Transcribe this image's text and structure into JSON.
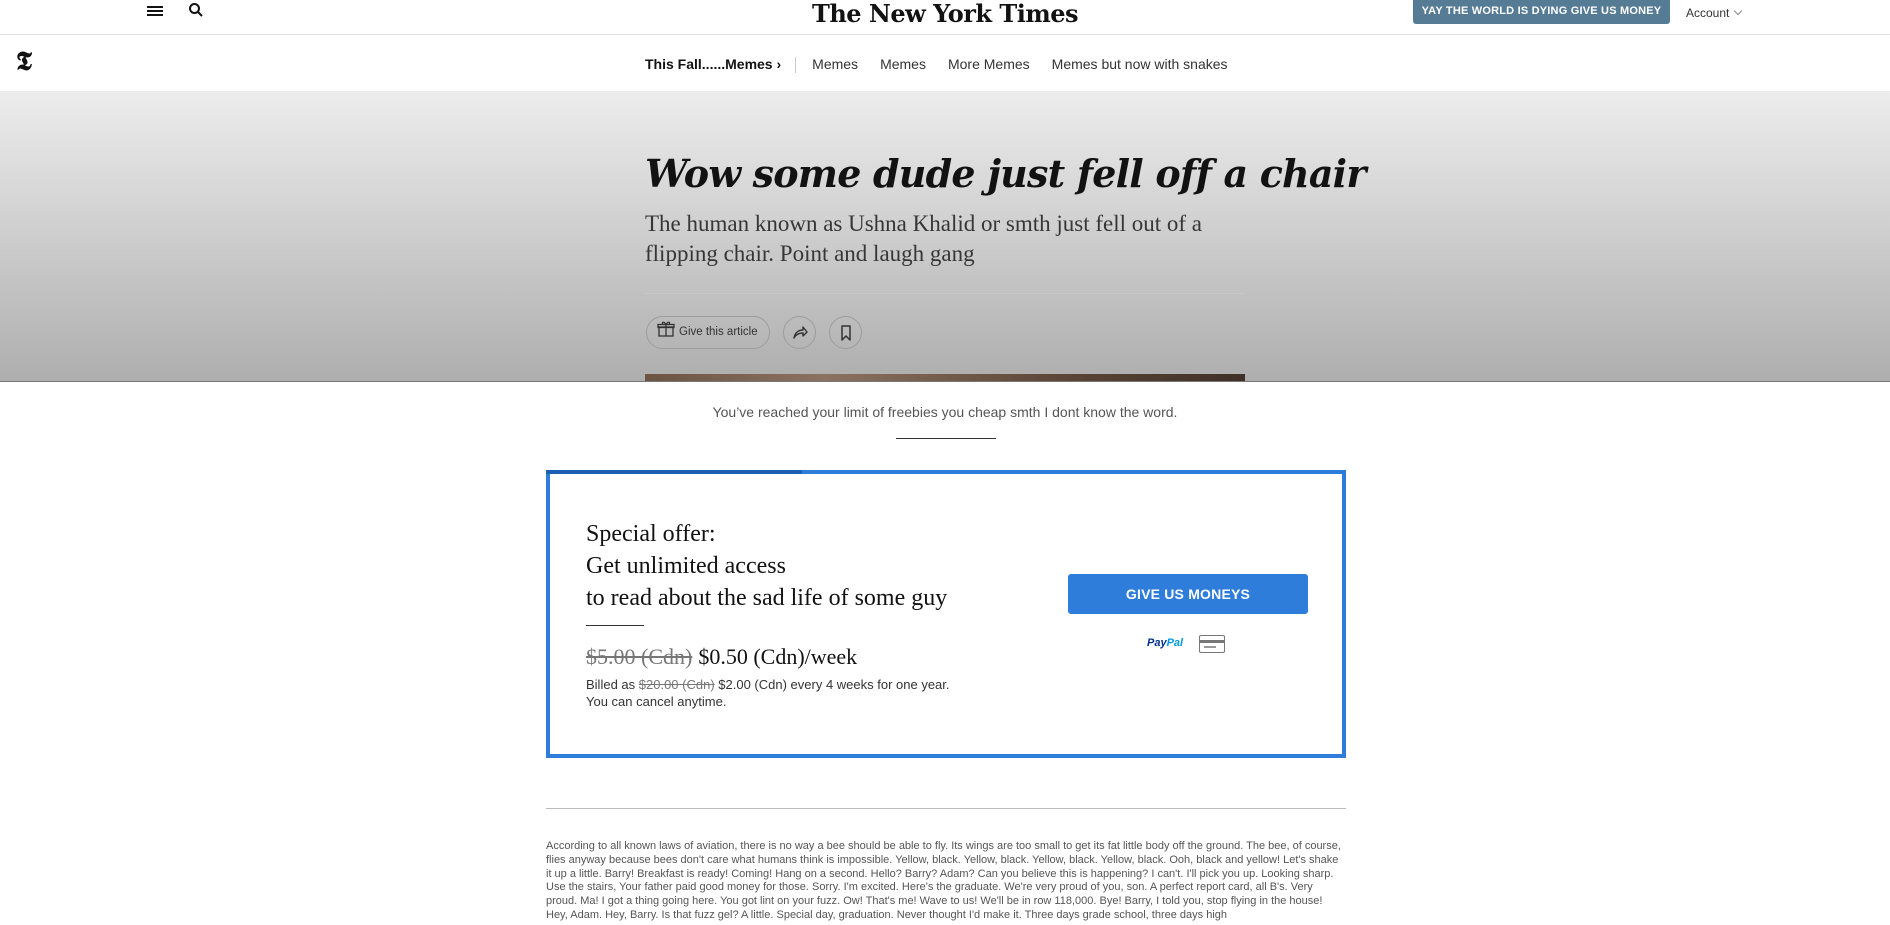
{
  "masthead": {
    "logo": "The New York Times",
    "subscribe_label": "YAY THE WORLD IS DYING GIVE US MONEY",
    "account_label": "Account"
  },
  "section_nav": {
    "t_logo": "𝕿",
    "lead": "This Fall......Memes ›",
    "items": [
      "Memes",
      "Memes",
      "More Memes",
      "Memes but now with snakes"
    ]
  },
  "article": {
    "headline": "Wow some dude just fell off a chair",
    "summary": "The human known as Ushna Khalid or smth just fell out of a flipping chair. Point and laugh gang",
    "gift_label": "Give this article"
  },
  "paywall": {
    "limit_message": "You’ve reached your limit of freebies you cheap smth I dont know the word.",
    "offer_line1": "Special offer:",
    "offer_line2": "Get unlimited access",
    "offer_line3": "to read about the sad life of some guy",
    "old_price": "$5.00 (Cdn)",
    "new_price": "$0.50 (Cdn)/week",
    "billed_prefix": "Billed as",
    "billed_old": "$20.00 (Cdn)",
    "billed_suffix": "$2.00 (Cdn) every 4 weeks for one year.",
    "cancel_note": "You can cancel anytime.",
    "cta_label": "GIVE US MONEYS",
    "paypal_a": "Pay",
    "paypal_b": "Pal"
  },
  "body_text": "According to all known laws of aviation, there is no way a bee should be able to fly. Its wings are too small to get its fat little body off the ground. The bee, of course, flies anyway because bees don't care what humans think is impossible. Yellow, black. Yellow, black. Yellow, black. Yellow, black. Ooh, black and yellow! Let's shake it up a little. Barry! Breakfast is ready! Coming! Hang on a second. Hello? Barry? Adam? Can you believe this is happening? I can't. I'll pick you up. Looking sharp. Use the stairs, Your father paid good money for those. Sorry. I'm excited. Here's the graduate. We're very proud of you, son. A perfect report card, all B's. Very proud. Ma! I got a thing going here. You got lint on your fuzz. Ow! That's me! Wave to us! We'll be in row 118,000. Bye! Barry, I told you, stop flying in the house! Hey, Adam. Hey, Barry. Is that fuzz gel? A little. Special day, graduation. Never thought I'd make it. Three days grade school, three days high"
}
